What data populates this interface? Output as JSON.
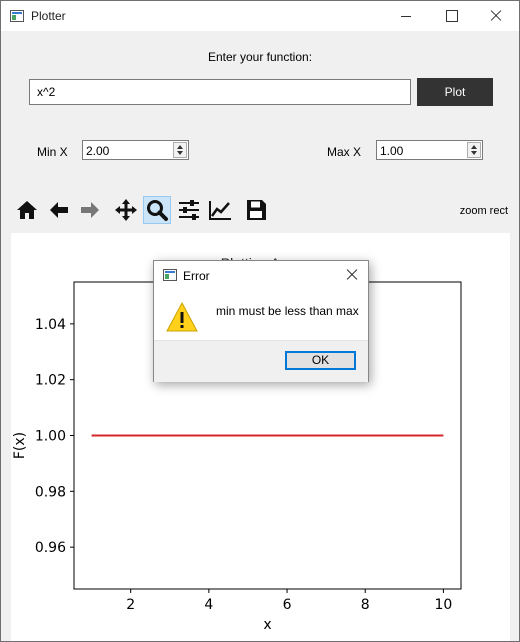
{
  "window": {
    "title": "Plotter"
  },
  "form": {
    "function_label": "Enter your function:",
    "function_value": "x^2",
    "plot_button": "Plot",
    "min_label": "Min X",
    "min_value": "2.00",
    "max_label": "Max X",
    "max_value": "1.00"
  },
  "toolbar": {
    "tools": [
      "home-icon",
      "back-icon",
      "forward-icon",
      "pan-icon",
      "zoom-icon",
      "configure-subplots-icon",
      "edit-axis-icon",
      "save-icon"
    ],
    "active_tool": "zoom-icon",
    "mode_text": "zoom rect"
  },
  "plot": {
    "title": "Plotting Area"
  },
  "chart_data": {
    "type": "line",
    "xlabel": "x",
    "ylabel": "F(x)",
    "x": [
      1,
      10
    ],
    "series": [
      {
        "values": [
          1.0,
          1.0
        ],
        "color": "#d62728"
      }
    ],
    "xlim": [
      0.55,
      10.45
    ],
    "ylim": [
      0.945,
      1.055
    ],
    "xticks": [
      2,
      4,
      6,
      8,
      10
    ],
    "yticks": [
      0.96,
      0.98,
      1.0,
      1.02,
      1.04
    ],
    "ytick_labels": [
      "0.96",
      "0.98",
      "1.00",
      "1.02",
      "1.04"
    ],
    "grid": false
  },
  "dialog": {
    "title": "Error",
    "message": "min must be less than max",
    "ok_label": "OK",
    "icon": "warning-icon"
  }
}
